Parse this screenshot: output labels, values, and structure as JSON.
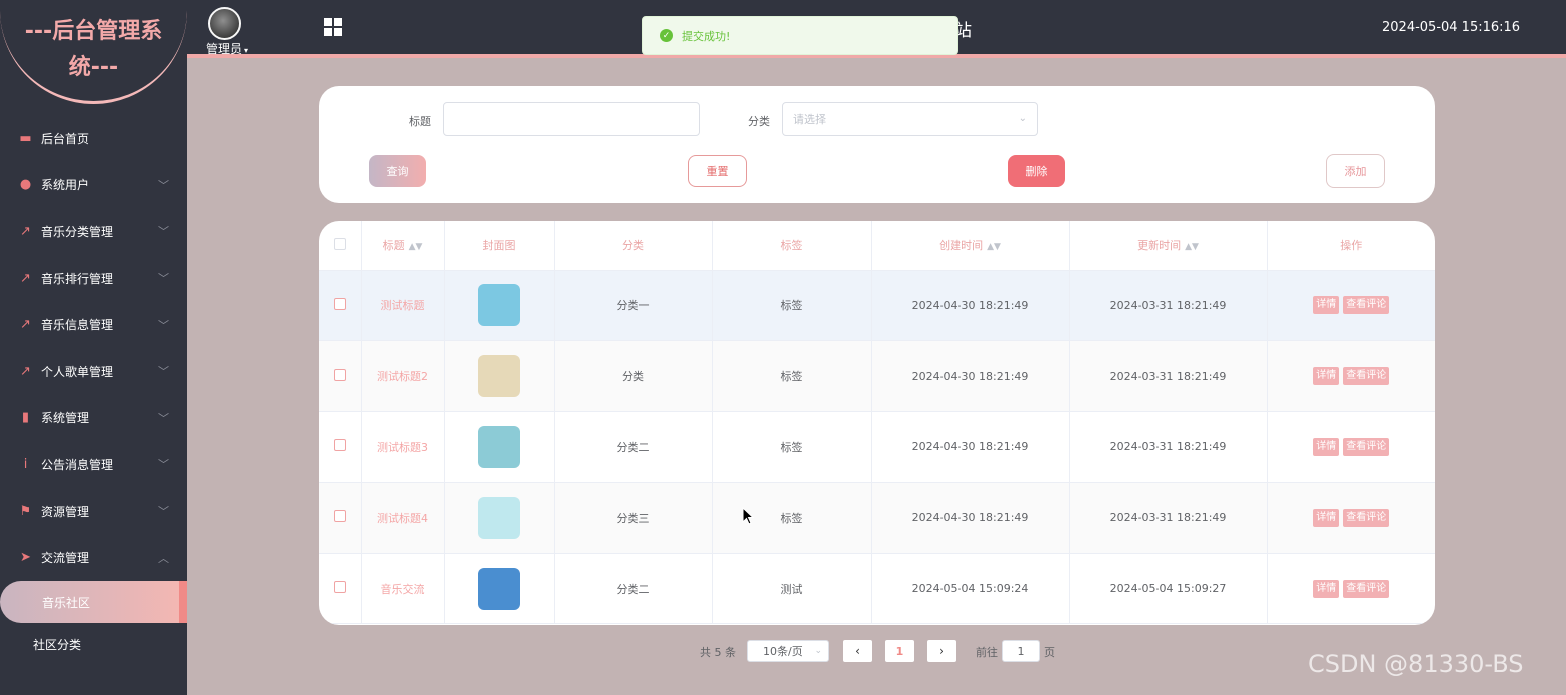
{
  "sidebar": {
    "logo": "---后台管理系统---",
    "items": [
      {
        "label": "后台首页",
        "icon": "monitor-icon",
        "has_children": false
      },
      {
        "label": "系统用户",
        "icon": "user-icon",
        "has_children": true
      },
      {
        "label": "音乐分类管理",
        "icon": "chart-icon",
        "has_children": true
      },
      {
        "label": "音乐排行管理",
        "icon": "chart-icon",
        "has_children": true
      },
      {
        "label": "音乐信息管理",
        "icon": "chart-icon",
        "has_children": true
      },
      {
        "label": "个人歌单管理",
        "icon": "chart-icon",
        "has_children": true
      },
      {
        "label": "系统管理",
        "icon": "bar-chart-icon",
        "has_children": true
      },
      {
        "label": "公告消息管理",
        "icon": "info-icon",
        "has_children": true
      },
      {
        "label": "资源管理",
        "icon": "flag-icon",
        "has_children": true
      },
      {
        "label": "交流管理",
        "icon": "send-icon",
        "has_children": true,
        "expanded": true
      }
    ],
    "active_sub": "音乐社区",
    "sub2": "社区分类"
  },
  "topbar": {
    "user": "管理员",
    "site_text": "站",
    "datetime": "2024-05-04 15:16:16"
  },
  "toast": {
    "text": "提交成功!"
  },
  "search": {
    "title_label": "标题",
    "title_value": "",
    "category_label": "分类",
    "category_placeholder": "请选择",
    "query_btn": "查询",
    "reset_btn": "重置",
    "delete_btn": "删除",
    "add_btn": "添加"
  },
  "table": {
    "headers": [
      "标题",
      "封面图",
      "分类",
      "标签",
      "创建时间",
      "更新时间",
      "操作"
    ],
    "rows": [
      {
        "title": "测试标题",
        "category": "分类一",
        "tag": "标签",
        "created": "2024-04-30 18:21:49",
        "updated": "2024-03-31 18:21:49",
        "thumb_color": "#7cc8e2"
      },
      {
        "title": "测试标题2",
        "category": "分类",
        "tag": "标签",
        "created": "2024-04-30 18:21:49",
        "updated": "2024-03-31 18:21:49",
        "thumb_color": "#e6d9b8"
      },
      {
        "title": "测试标题3",
        "category": "分类二",
        "tag": "标签",
        "created": "2024-04-30 18:21:49",
        "updated": "2024-03-31 18:21:49",
        "thumb_color": "#8ccbd6"
      },
      {
        "title": "测试标题4",
        "category": "分类三",
        "tag": "标签",
        "created": "2024-04-30 18:21:49",
        "updated": "2024-03-31 18:21:49",
        "thumb_color": "#bfe8ee"
      },
      {
        "title": "音乐交流",
        "category": "分类二",
        "tag": "测试",
        "created": "2024-05-04 15:09:24",
        "updated": "2024-05-04 15:09:27",
        "thumb_color": "#4a8ed0"
      }
    ],
    "op_detail": "详情",
    "op_comments": "查看评论"
  },
  "pagination": {
    "total": "共 5 条",
    "page_size": "10条/页",
    "current": "1",
    "goto_prefix": "前往",
    "goto_value": "1",
    "goto_suffix": "页"
  },
  "watermark": "CSDN @81330-BS"
}
